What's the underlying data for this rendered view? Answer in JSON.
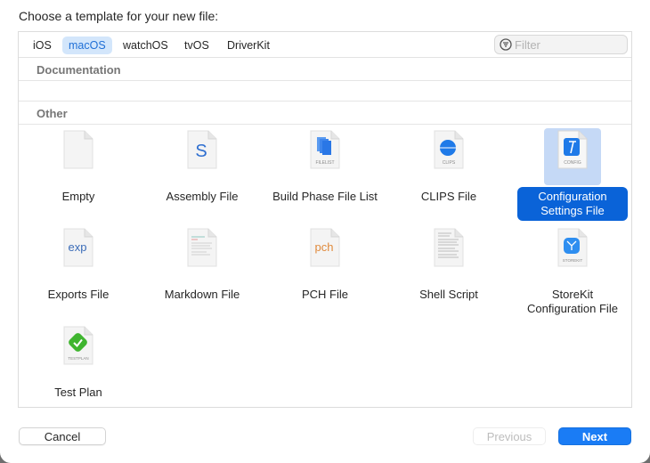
{
  "dialog": {
    "prompt": "Choose a template for your new file:"
  },
  "platform_tabs": [
    {
      "label": "iOS",
      "active": false
    },
    {
      "label": "macOS",
      "active": true
    },
    {
      "label": "watchOS",
      "active": false
    },
    {
      "label": "tvOS",
      "active": false
    },
    {
      "label": "DriverKit",
      "active": false
    }
  ],
  "filter": {
    "placeholder": "Filter",
    "value": "",
    "icon": "filter-icon"
  },
  "sections": [
    {
      "title": "Documentation",
      "items": []
    },
    {
      "title": "Other"
    }
  ],
  "templates": [
    {
      "label": "Empty",
      "icon": "empty-file-icon",
      "selected": false
    },
    {
      "label": "Assembly File",
      "icon": "assembly-file-icon",
      "glyph": "S",
      "selected": false
    },
    {
      "label": "Build Phase File List",
      "icon": "filelist-icon",
      "badge": "FILELIST",
      "selected": false
    },
    {
      "label": "CLIPS File",
      "icon": "clips-file-icon",
      "badge": "CLIPS",
      "selected": false
    },
    {
      "label": "Configuration Settings File",
      "icon": "config-file-icon",
      "badge": "CONFIG",
      "selected": true
    },
    {
      "label": "Exports File",
      "icon": "exports-file-icon",
      "glyph": "exp",
      "selected": false
    },
    {
      "label": "Markdown File",
      "icon": "markdown-file-icon",
      "selected": false
    },
    {
      "label": "PCH File",
      "icon": "pch-file-icon",
      "glyph": "pch",
      "selected": false
    },
    {
      "label": "Shell Script",
      "icon": "shell-script-icon",
      "selected": false
    },
    {
      "label": "StoreKit Configuration File",
      "icon": "storekit-file-icon",
      "badge": "STOREKIT",
      "selected": false
    },
    {
      "label": "Test Plan",
      "icon": "testplan-file-icon",
      "badge": "TESTPLAN",
      "selected": false
    }
  ],
  "buttons": {
    "cancel": "Cancel",
    "previous": "Previous",
    "next": "Next"
  },
  "colors": {
    "accent": "#1a7cf5",
    "selection": "#0a63d8",
    "selection_bg": "#c5d9f6",
    "tab_active_bg": "#d3e6fb",
    "tab_active_text": "#1f6fd6",
    "assembly_glyph": "#2f6fd0",
    "exp_glyph": "#3b6cb8",
    "pch_glyph": "#e08a3c",
    "testplan_green": "#3fb52f"
  }
}
